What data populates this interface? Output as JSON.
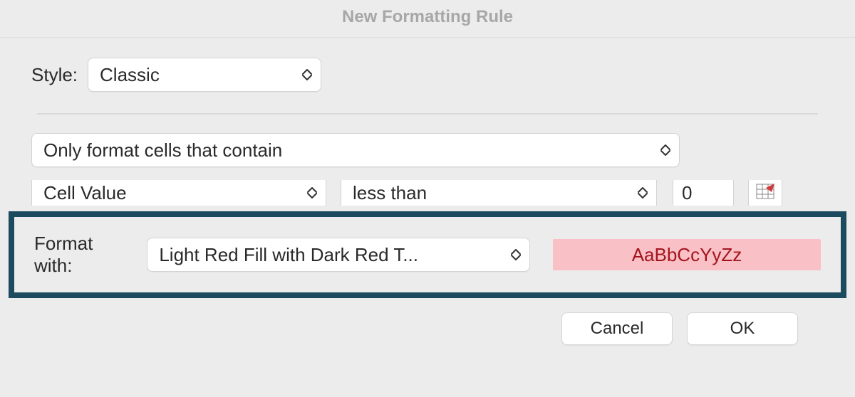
{
  "title": "New Formatting Rule",
  "style": {
    "label": "Style:",
    "value": "Classic"
  },
  "rule_type": "Only format cells that contain",
  "condition": {
    "subject": "Cell Value",
    "operator": "less than",
    "value": "0"
  },
  "format": {
    "label": "Format with:",
    "preset": "Light Red Fill with Dark Red T...",
    "preview_text": "AaBbCcYyZz",
    "preview_fill": "#f9c0c5",
    "preview_color": "#a4141f"
  },
  "buttons": {
    "cancel": "Cancel",
    "ok": "OK"
  },
  "icons": {
    "updown": "updown-caret",
    "cellref": "cell-reference-icon"
  }
}
